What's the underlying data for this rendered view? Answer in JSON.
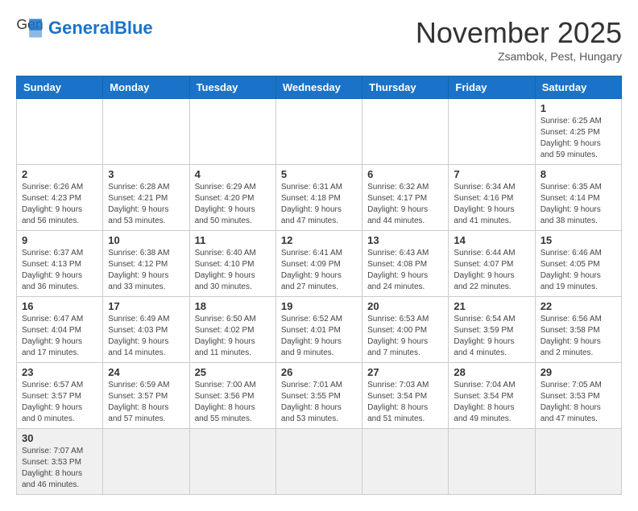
{
  "header": {
    "logo_general": "General",
    "logo_blue": "Blue",
    "month": "November 2025",
    "location": "Zsambok, Pest, Hungary"
  },
  "days_of_week": [
    "Sunday",
    "Monday",
    "Tuesday",
    "Wednesday",
    "Thursday",
    "Friday",
    "Saturday"
  ],
  "weeks": [
    [
      {
        "day": "",
        "info": ""
      },
      {
        "day": "",
        "info": ""
      },
      {
        "day": "",
        "info": ""
      },
      {
        "day": "",
        "info": ""
      },
      {
        "day": "",
        "info": ""
      },
      {
        "day": "",
        "info": ""
      },
      {
        "day": "1",
        "info": "Sunrise: 6:25 AM\nSunset: 4:25 PM\nDaylight: 9 hours\nand 59 minutes."
      }
    ],
    [
      {
        "day": "2",
        "info": "Sunrise: 6:26 AM\nSunset: 4:23 PM\nDaylight: 9 hours\nand 56 minutes."
      },
      {
        "day": "3",
        "info": "Sunrise: 6:28 AM\nSunset: 4:21 PM\nDaylight: 9 hours\nand 53 minutes."
      },
      {
        "day": "4",
        "info": "Sunrise: 6:29 AM\nSunset: 4:20 PM\nDaylight: 9 hours\nand 50 minutes."
      },
      {
        "day": "5",
        "info": "Sunrise: 6:31 AM\nSunset: 4:18 PM\nDaylight: 9 hours\nand 47 minutes."
      },
      {
        "day": "6",
        "info": "Sunrise: 6:32 AM\nSunset: 4:17 PM\nDaylight: 9 hours\nand 44 minutes."
      },
      {
        "day": "7",
        "info": "Sunrise: 6:34 AM\nSunset: 4:16 PM\nDaylight: 9 hours\nand 41 minutes."
      },
      {
        "day": "8",
        "info": "Sunrise: 6:35 AM\nSunset: 4:14 PM\nDaylight: 9 hours\nand 38 minutes."
      }
    ],
    [
      {
        "day": "9",
        "info": "Sunrise: 6:37 AM\nSunset: 4:13 PM\nDaylight: 9 hours\nand 36 minutes."
      },
      {
        "day": "10",
        "info": "Sunrise: 6:38 AM\nSunset: 4:12 PM\nDaylight: 9 hours\nand 33 minutes."
      },
      {
        "day": "11",
        "info": "Sunrise: 6:40 AM\nSunset: 4:10 PM\nDaylight: 9 hours\nand 30 minutes."
      },
      {
        "day": "12",
        "info": "Sunrise: 6:41 AM\nSunset: 4:09 PM\nDaylight: 9 hours\nand 27 minutes."
      },
      {
        "day": "13",
        "info": "Sunrise: 6:43 AM\nSunset: 4:08 PM\nDaylight: 9 hours\nand 24 minutes."
      },
      {
        "day": "14",
        "info": "Sunrise: 6:44 AM\nSunset: 4:07 PM\nDaylight: 9 hours\nand 22 minutes."
      },
      {
        "day": "15",
        "info": "Sunrise: 6:46 AM\nSunset: 4:05 PM\nDaylight: 9 hours\nand 19 minutes."
      }
    ],
    [
      {
        "day": "16",
        "info": "Sunrise: 6:47 AM\nSunset: 4:04 PM\nDaylight: 9 hours\nand 17 minutes."
      },
      {
        "day": "17",
        "info": "Sunrise: 6:49 AM\nSunset: 4:03 PM\nDaylight: 9 hours\nand 14 minutes."
      },
      {
        "day": "18",
        "info": "Sunrise: 6:50 AM\nSunset: 4:02 PM\nDaylight: 9 hours\nand 11 minutes."
      },
      {
        "day": "19",
        "info": "Sunrise: 6:52 AM\nSunset: 4:01 PM\nDaylight: 9 hours\nand 9 minutes."
      },
      {
        "day": "20",
        "info": "Sunrise: 6:53 AM\nSunset: 4:00 PM\nDaylight: 9 hours\nand 7 minutes."
      },
      {
        "day": "21",
        "info": "Sunrise: 6:54 AM\nSunset: 3:59 PM\nDaylight: 9 hours\nand 4 minutes."
      },
      {
        "day": "22",
        "info": "Sunrise: 6:56 AM\nSunset: 3:58 PM\nDaylight: 9 hours\nand 2 minutes."
      }
    ],
    [
      {
        "day": "23",
        "info": "Sunrise: 6:57 AM\nSunset: 3:57 PM\nDaylight: 9 hours\nand 0 minutes."
      },
      {
        "day": "24",
        "info": "Sunrise: 6:59 AM\nSunset: 3:57 PM\nDaylight: 8 hours\nand 57 minutes."
      },
      {
        "day": "25",
        "info": "Sunrise: 7:00 AM\nSunset: 3:56 PM\nDaylight: 8 hours\nand 55 minutes."
      },
      {
        "day": "26",
        "info": "Sunrise: 7:01 AM\nSunset: 3:55 PM\nDaylight: 8 hours\nand 53 minutes."
      },
      {
        "day": "27",
        "info": "Sunrise: 7:03 AM\nSunset: 3:54 PM\nDaylight: 8 hours\nand 51 minutes."
      },
      {
        "day": "28",
        "info": "Sunrise: 7:04 AM\nSunset: 3:54 PM\nDaylight: 8 hours\nand 49 minutes."
      },
      {
        "day": "29",
        "info": "Sunrise: 7:05 AM\nSunset: 3:53 PM\nDaylight: 8 hours\nand 47 minutes."
      }
    ],
    [
      {
        "day": "30",
        "info": "Sunrise: 7:07 AM\nSunset: 3:53 PM\nDaylight: 8 hours\nand 46 minutes."
      },
      {
        "day": "",
        "info": ""
      },
      {
        "day": "",
        "info": ""
      },
      {
        "day": "",
        "info": ""
      },
      {
        "day": "",
        "info": ""
      },
      {
        "day": "",
        "info": ""
      },
      {
        "day": "",
        "info": ""
      }
    ]
  ]
}
